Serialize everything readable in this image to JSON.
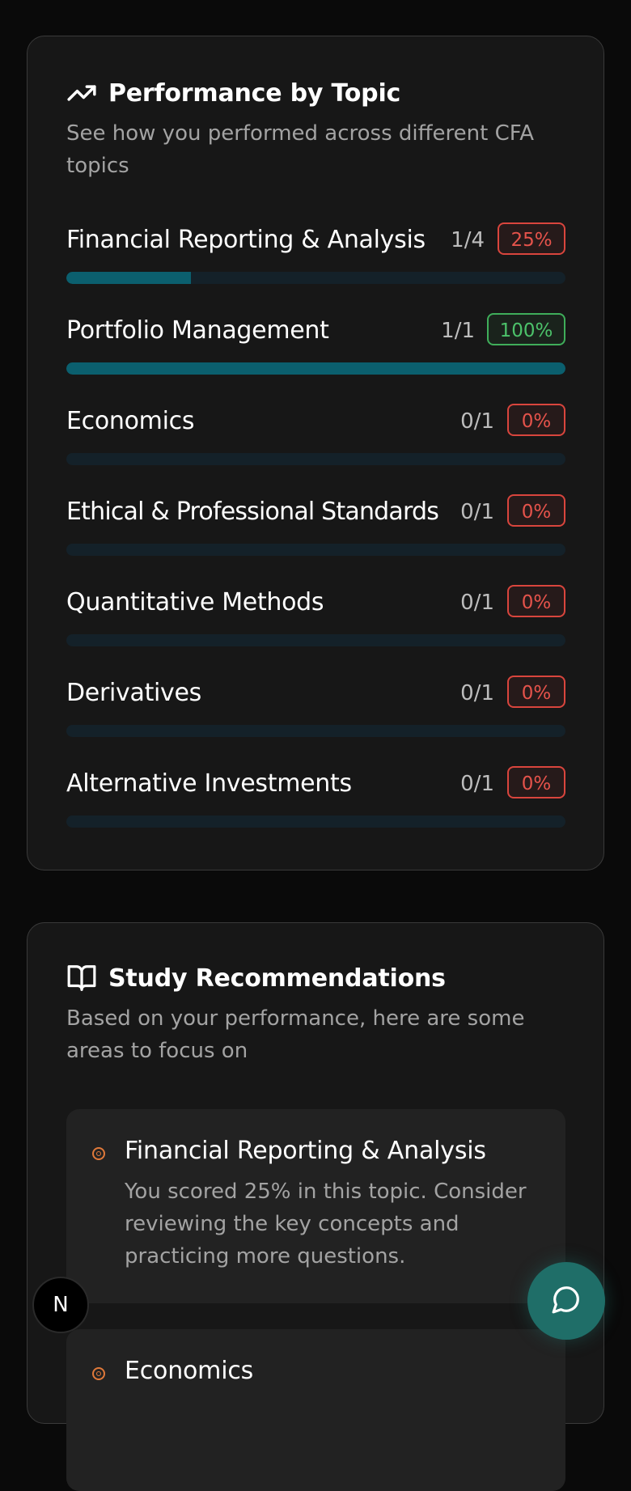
{
  "performance": {
    "title": "Performance by Topic",
    "description": "See how you performed across different CFA topics",
    "topics": [
      {
        "name": "Financial Reporting & Analysis",
        "score": "1/4",
        "percent": "25%",
        "progress": 0.25,
        "status": "low"
      },
      {
        "name": "Portfolio Management",
        "score": "1/1",
        "percent": "100%",
        "progress": 1.0,
        "status": "good"
      },
      {
        "name": "Economics",
        "score": "0/1",
        "percent": "0%",
        "progress": 0,
        "status": "low"
      },
      {
        "name": "Ethical & Professional Standards",
        "score": "0/1",
        "percent": "0%",
        "progress": 0,
        "status": "low"
      },
      {
        "name": "Quantitative Methods",
        "score": "0/1",
        "percent": "0%",
        "progress": 0,
        "status": "low"
      },
      {
        "name": "Derivatives",
        "score": "0/1",
        "percent": "0%",
        "progress": 0,
        "status": "low"
      },
      {
        "name": "Alternative Investments",
        "score": "0/1",
        "percent": "0%",
        "progress": 0,
        "status": "low"
      }
    ]
  },
  "study": {
    "title": "Study Recommendations",
    "description": "Based on your performance, here are some areas to focus on",
    "items": [
      {
        "title": "Financial Reporting & Analysis",
        "text": "You scored 25% in this topic. Consider reviewing the key concepts and practicing more questions."
      },
      {
        "title": "Economics",
        "text": ""
      }
    ]
  },
  "floating": {
    "n_badge": "N"
  },
  "colors": {
    "accent": "#0b5f6e",
    "low": "#e5534b",
    "good": "#4cc26a",
    "chat": "#1f6e68"
  }
}
